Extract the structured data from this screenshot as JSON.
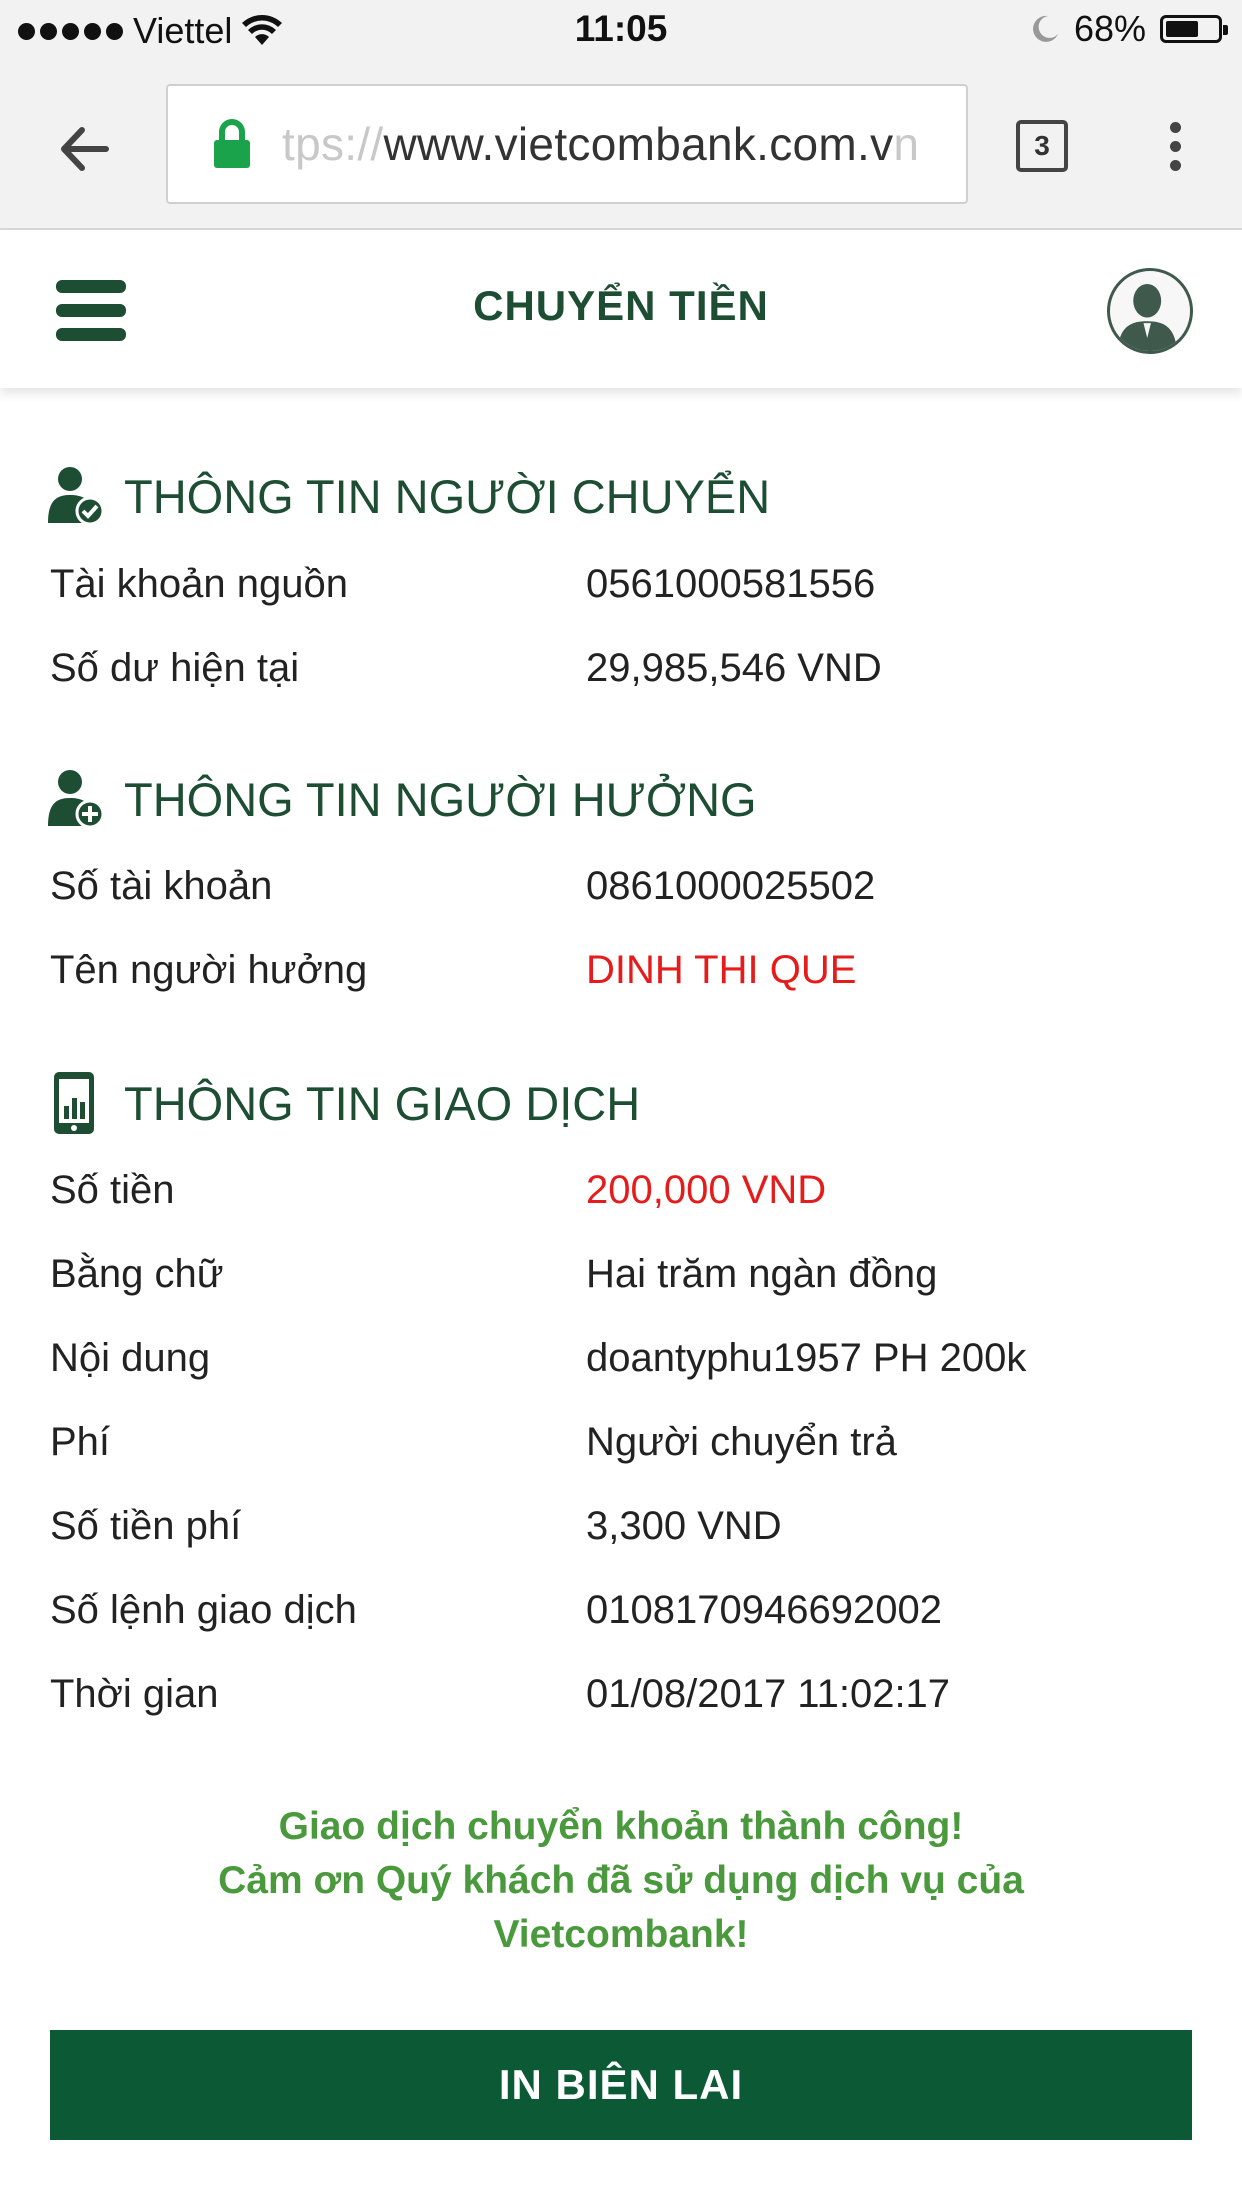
{
  "status_bar": {
    "carrier": "Viettel",
    "time": "11:05",
    "battery": "68%",
    "battery_level": 0.68
  },
  "browser": {
    "url_faded": "tps://",
    "url_main": "www.vietcombank.com.v",
    "url_tail": "n",
    "tab_count": "3"
  },
  "header": {
    "title": "CHUYỂN TIỀN"
  },
  "sender": {
    "title": "THÔNG TIN NGƯỜI CHUYỂN",
    "rows": [
      {
        "label": "Tài khoản nguồn",
        "value": "0561000581556"
      },
      {
        "label": "Số dư hiện tại",
        "value": "29,985,546 VND"
      }
    ]
  },
  "beneficiary": {
    "title": "THÔNG TIN NGƯỜI HƯỞNG",
    "rows": [
      {
        "label": "Số tài khoản",
        "value": "0861000025502"
      },
      {
        "label": "Tên người hưởng",
        "value": "DINH THI QUE"
      }
    ]
  },
  "transaction": {
    "title": "THÔNG TIN GIAO DỊCH",
    "rows": [
      {
        "label": "Số tiền",
        "value": "200,000 VND"
      },
      {
        "label": "Bằng chữ",
        "value": "Hai trăm ngàn đồng"
      },
      {
        "label": "Nội dung",
        "value": "doantyphu1957 PH 200k"
      },
      {
        "label": "Phí",
        "value": "Người chuyển trả"
      },
      {
        "label": "Số tiền phí",
        "value": "3,300 VND"
      },
      {
        "label": "Số lệnh giao dịch",
        "value": "0108170946692002"
      },
      {
        "label": "Thời gian",
        "value": "01/08/2017 11:02:17"
      }
    ]
  },
  "message": {
    "line1": "Giao dịch chuyển khoản thành công!",
    "line2": "Cảm ơn Quý khách đã sử dụng dịch vụ của",
    "line3": "Vietcombank!"
  },
  "print_button": "IN BIÊN LAI",
  "colors": {
    "brand_green": "#1d4e34",
    "button_green": "#0b5a35",
    "highlight_red": "#e51c1c",
    "success_green": "#4a9a3d"
  }
}
